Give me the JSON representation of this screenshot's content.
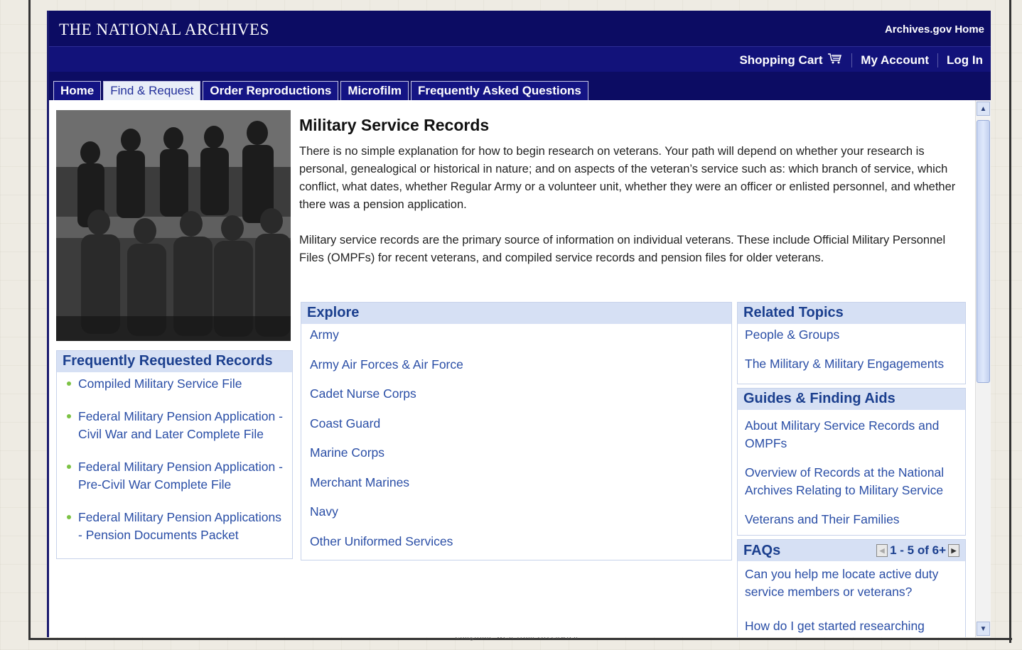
{
  "header": {
    "site_title": "THE NATIONAL ARCHIVES",
    "home_link": "Archives.gov Home"
  },
  "account_bar": {
    "shopping_cart": "Shopping Cart",
    "my_account": "My Account",
    "log_in": "Log In"
  },
  "tabs": [
    {
      "label": "Home",
      "active": false
    },
    {
      "label": "Find & Request",
      "active": true
    },
    {
      "label": "Order Reproductions",
      "active": false
    },
    {
      "label": "Microfilm",
      "active": false
    },
    {
      "label": "Frequently Asked Questions",
      "active": false
    }
  ],
  "main": {
    "title": "Military Service Records",
    "paragraphs": [
      "There is no simple explanation for how to begin research on veterans. Your path will depend on whether your research is personal, genealogical or historical in nature; and on aspects of the veteran’s service such as: which branch of service, which conflict, what dates, whether Regular Army or a volunteer unit, whether they were an officer or enlisted personnel, and whether there was a pension application.",
      "Military service records are the primary source of information on individual veterans. These include Official Military Personnel Files (OMPFs) for recent veterans, and compiled service records and pension files for older veterans."
    ]
  },
  "frequently_requested": {
    "heading": "Frequently Requested Records",
    "items": [
      "Compiled Military Service File",
      "Federal Military Pension Application - Civil War and Later Complete File",
      "Federal Military Pension Application - Pre-Civil War Complete File",
      "Federal Military Pension Applications - Pension Documents Packet"
    ]
  },
  "explore": {
    "heading": "Explore",
    "items": [
      "Army",
      "Army Air Forces & Air Force",
      "Cadet Nurse Corps",
      "Coast Guard",
      "Marine Corps",
      "Merchant Marines",
      "Navy",
      "Other Uniformed Services"
    ]
  },
  "related_topics": {
    "heading": "Related Topics",
    "items": [
      "People & Groups",
      "The Military & Military Engagements"
    ]
  },
  "guides": {
    "heading": "Guides & Finding Aids",
    "items": [
      "About Military Service Records and OMPFs",
      "Overview of Records at the National Archives Relating to Military Service",
      "Veterans and Their Families"
    ]
  },
  "faqs": {
    "heading": "FAQs",
    "pager": "1 - 5 of 6+",
    "items": [
      "Can you help me locate active duty service members or veterans?",
      "How do I get started researching military"
    ]
  },
  "map_footer_text": "Longitude West from Greenwich",
  "colors": {
    "header_bg": "#0c0c63",
    "link": "#2a4ea6",
    "box_head_bg": "#d6e0f4",
    "bullet": "#7cc244"
  },
  "icons": [
    "shopping-cart-icon",
    "pager-prev-icon",
    "pager-next-icon",
    "scroll-up-icon",
    "scroll-down-icon"
  ]
}
